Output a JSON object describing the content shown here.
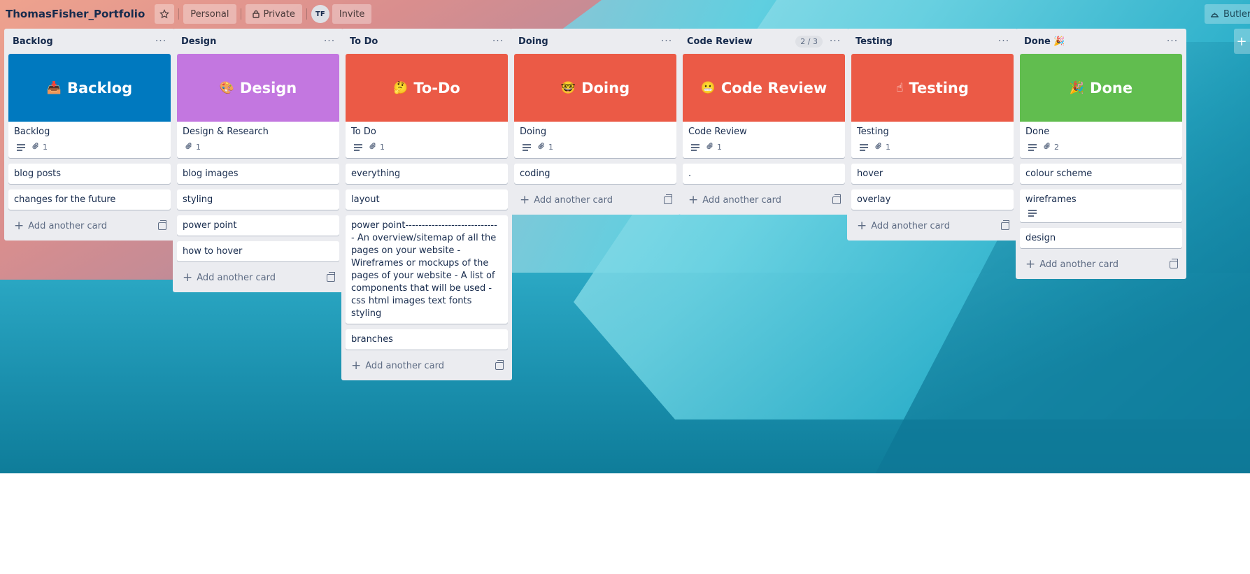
{
  "header": {
    "board_title": "ThomasFisher_Portfolio",
    "star_icon": "star-icon",
    "workspace_label": "Personal",
    "visibility_label": "Private",
    "avatar_initials": "TF",
    "invite_label": "Invite",
    "butler_label": "Butler"
  },
  "add_card_label": "Add another card",
  "lists": [
    {
      "title": "Backlog",
      "cover": {
        "emoji": "📥",
        "label": "Backlog",
        "color": "#0079bf"
      },
      "cover_card": {
        "title": "Backlog",
        "attachments": "1"
      },
      "cards": [
        "blog posts",
        "changes for the future"
      ]
    },
    {
      "title": "Design",
      "cover": {
        "emoji": "🎨",
        "label": "Design",
        "color": "#c377e0"
      },
      "cover_card": {
        "title": "Design & Research",
        "attachments": "1"
      },
      "cards": [
        "blog images",
        "styling",
        "power point",
        "how to hover"
      ]
    },
    {
      "title": "To Do",
      "cover": {
        "emoji": "🤔",
        "label": "To-Do",
        "color": "#eb5a46"
      },
      "cover_card": {
        "title": "To Do",
        "attachments": "1"
      },
      "cards": [
        "everything",
        "layout",
        "power point---------------------------- - An overview/sitemap of all the pages on your website - Wireframes or mockups of the pages of your website - A list of components that will be used - css html images text fonts styling",
        "branches"
      ]
    },
    {
      "title": "Doing",
      "cover": {
        "emoji": "🤓",
        "label": "Doing",
        "color": "#eb5a46"
      },
      "cover_card": {
        "title": "Doing",
        "attachments": "1"
      },
      "cards": [
        "coding"
      ]
    },
    {
      "title": "Code Review",
      "wip": "2 / 3",
      "cover": {
        "emoji": "😬",
        "label": "Code Review",
        "color": "#eb5a46"
      },
      "cover_card": {
        "title": "Code Review",
        "attachments": "1"
      },
      "cards": [
        "."
      ]
    },
    {
      "title": "Testing",
      "cover": {
        "emoji": "☝",
        "label": "Testing",
        "color": "#eb5a46"
      },
      "cover_card": {
        "title": "Testing",
        "attachments": "1"
      },
      "cards": [
        "hover",
        "overlay"
      ]
    },
    {
      "title": "Done 🎉",
      "cover": {
        "emoji": "🎉",
        "label": "Done",
        "color": "#61bd4f"
      },
      "cover_card": {
        "title": "Done",
        "attachments": "2"
      },
      "cards": [
        "colour scheme",
        "wireframes",
        "design"
      ]
    }
  ]
}
